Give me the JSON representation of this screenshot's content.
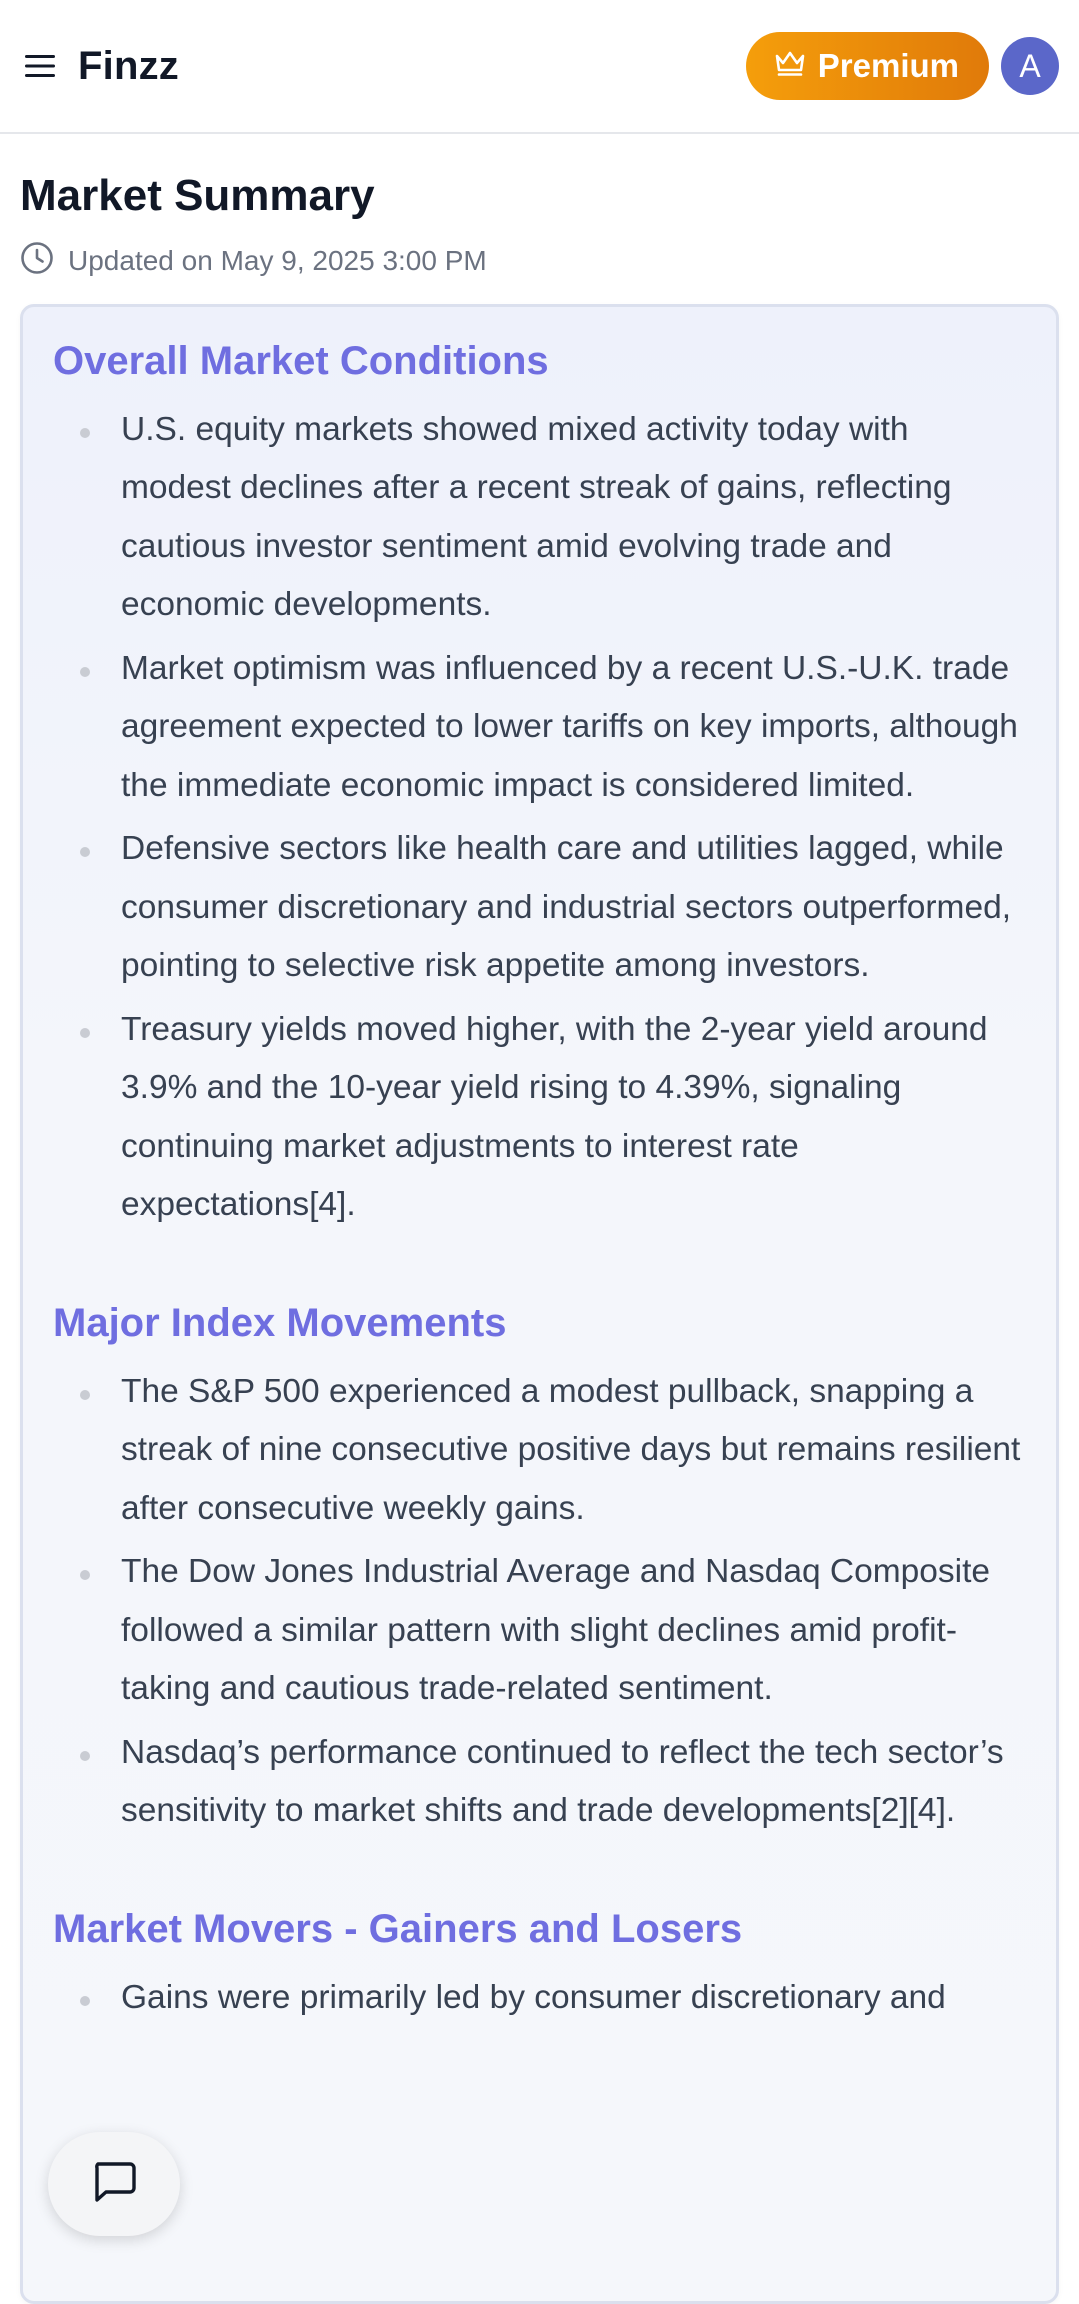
{
  "app": {
    "name": "Finzz"
  },
  "header": {
    "premium_label": "Premium",
    "avatar_initial": "A"
  },
  "page": {
    "title": "Market Summary",
    "updated": "Updated on May 9, 2025 3:00 PM"
  },
  "sections": [
    {
      "title": "Overall Market Conditions",
      "items": [
        "U.S. equity markets showed mixed activity today with modest declines after a recent streak of gains, reflecting cautious investor sentiment amid evolving trade and economic developments.",
        "Market optimism was influenced by a recent U.S.-U.K. trade agreement expected to lower tariffs on key imports, although the immediate economic impact is considered limited.",
        "Defensive sectors like health care and utilities lagged, while consumer discretionary and industrial sectors outperformed, pointing to selective risk appetite among investors.",
        "Treasury yields moved higher, with the 2-year yield around 3.9% and the 10-year yield rising to 4.39%, signaling continuing market adjustments to interest rate expectations[4]."
      ]
    },
    {
      "title": "Major Index Movements",
      "items": [
        "The S&P 500 experienced a modest pullback, snapping a streak of nine consecutive positive days but remains resilient after consecutive weekly gains.",
        "The Dow Jones Industrial Average and Nasdaq Composite followed a similar pattern with slight declines amid profit-taking and cautious trade-related sentiment.",
        "Nasdaq’s performance continued to reflect the tech sector’s sensitivity to market shifts and trade developments[2][4]."
      ]
    },
    {
      "title": "Market Movers - Gainers and Losers",
      "items": [
        "Gains were primarily led by consumer discretionary and"
      ]
    }
  ],
  "icons": {
    "menu": "hamburger-menu-icon",
    "premium": "crown-icon",
    "updated": "clock-icon",
    "chat": "chat-bubble-icon"
  },
  "colors": {
    "accent": "#6f6ee0",
    "premium_start": "#f59e0b",
    "premium_end": "#e07a0a",
    "avatar": "#5b67c9"
  }
}
